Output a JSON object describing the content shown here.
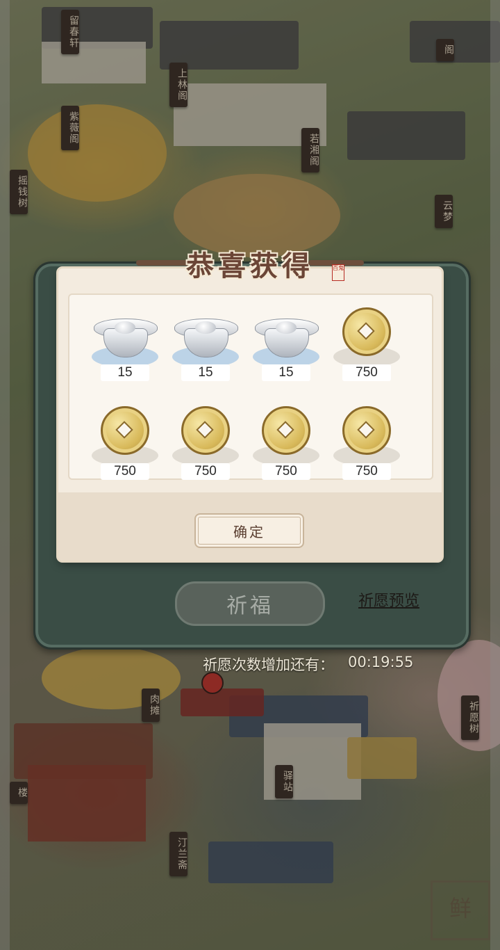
{
  "background": {
    "signs": [
      "留春轩",
      "上林阁",
      "紫薇阁",
      "摇钱树",
      "若湘阁",
      "云梦",
      "阁",
      "肉摊",
      "驿站",
      "祈愿树",
      "汀兰斋",
      "楼"
    ],
    "logo_text": "鲜"
  },
  "wish_panel": {
    "pray_button": "祈福",
    "preview_link": "祈愿预览",
    "timer_label": "祈愿次数增加还有：",
    "timer_value": "00:19:55"
  },
  "reward_dialog": {
    "title": "恭喜获得",
    "seal_text": "百鬼",
    "confirm_button": "确定",
    "items": [
      {
        "icon": "silver-ingot-icon",
        "quantity": "15"
      },
      {
        "icon": "silver-ingot-icon",
        "quantity": "15"
      },
      {
        "icon": "silver-ingot-icon",
        "quantity": "15"
      },
      {
        "icon": "copper-coin-icon",
        "quantity": "750"
      },
      {
        "icon": "copper-coin-icon",
        "quantity": "750"
      },
      {
        "icon": "copper-coin-icon",
        "quantity": "750"
      },
      {
        "icon": "copper-coin-icon",
        "quantity": "750"
      },
      {
        "icon": "copper-coin-icon",
        "quantity": "750"
      }
    ]
  },
  "colors": {
    "title": "#6b4536",
    "panel": "#3a4d45",
    "dialog": "#f3ebdf"
  }
}
